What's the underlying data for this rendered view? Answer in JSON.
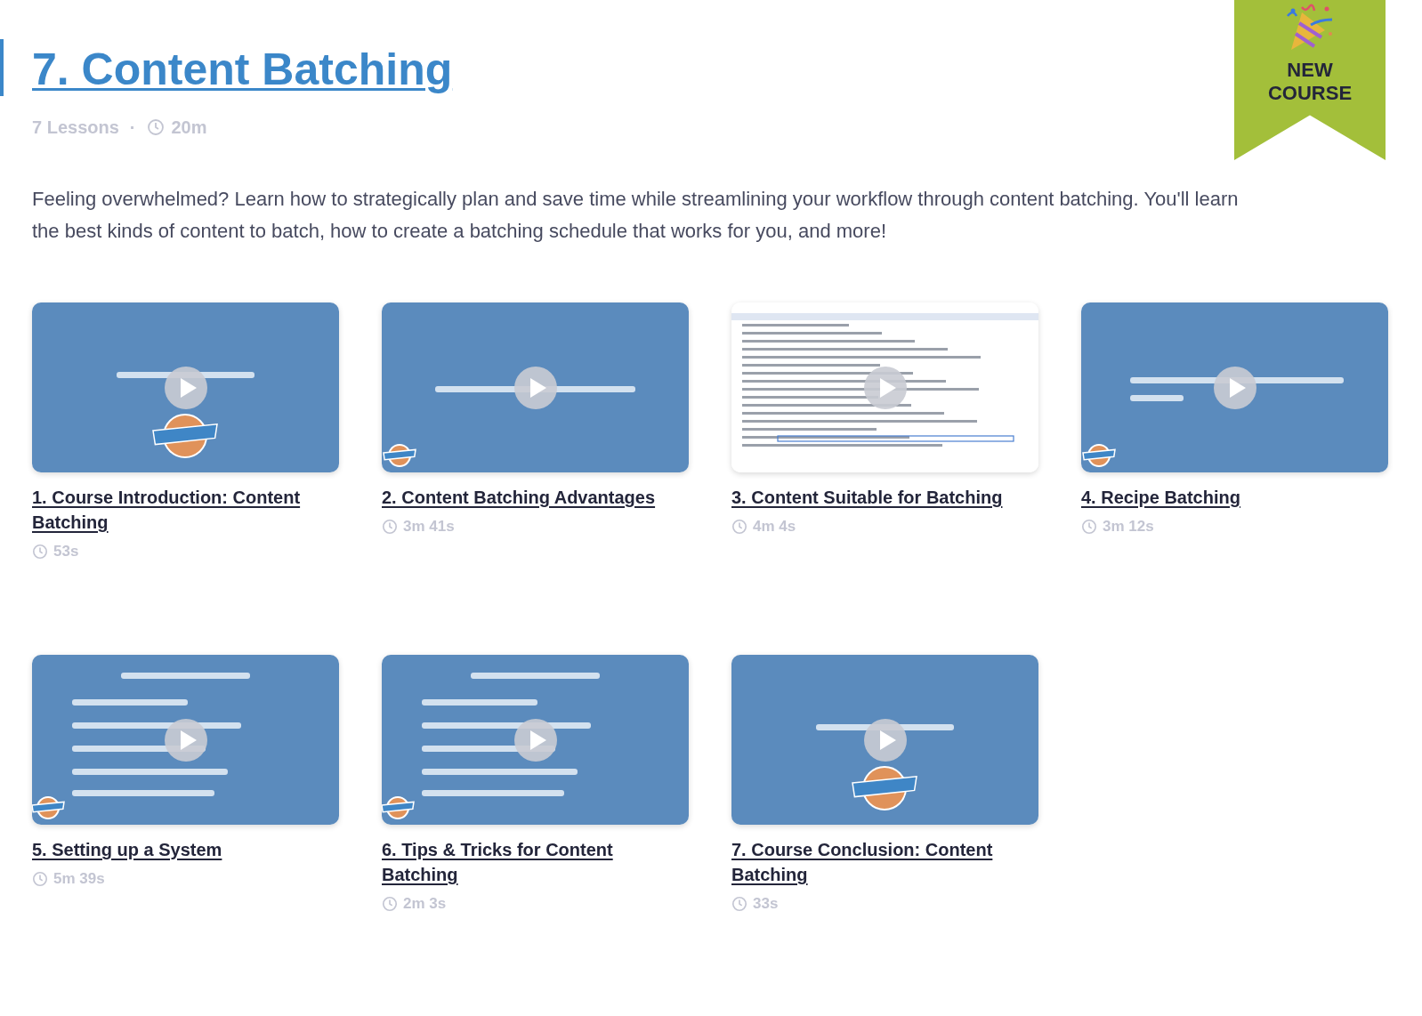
{
  "ribbon": {
    "label_line_1": "NEW",
    "label_line_2": "COURSE"
  },
  "course": {
    "title": "7. Content Batching",
    "lessons": "7 Lessons",
    "separator": "·",
    "duration": "20m",
    "description": "Feeling overwhelmed? Learn how to strategically plan and save time while streamlining your workflow through content batching. You'll learn the best kinds of content to batch, how to create a batching schedule that works for you, and more!"
  },
  "lessons": [
    {
      "title": "1. Course Introduction: Content Batching",
      "duration": "53s"
    },
    {
      "title": "2. Content Batching Advantages",
      "duration": "3m 41s"
    },
    {
      "title": "3. Content Suitable for Batching",
      "duration": "4m 4s"
    },
    {
      "title": "4. Recipe Batching",
      "duration": "3m 12s"
    },
    {
      "title": "5. Setting up a System",
      "duration": "5m 39s"
    },
    {
      "title": "6. Tips & Tricks for Content Batching",
      "duration": "2m 3s"
    },
    {
      "title": "7. Course Conclusion: Content Batching",
      "duration": "33s"
    }
  ]
}
